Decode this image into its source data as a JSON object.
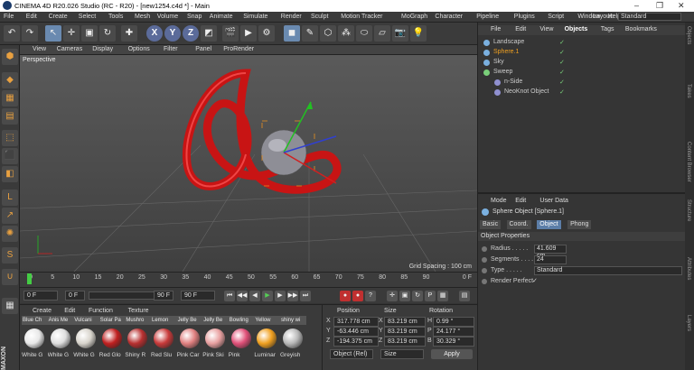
{
  "window": {
    "title": "CINEMA 4D R20.026 Studio (RC - R20) - [new1254.c4d *] - Main",
    "layout_label": "Layout:",
    "layout_value": "Standard"
  },
  "menu": [
    "File",
    "Edit",
    "Create",
    "Select",
    "Tools",
    "Mesh",
    "Volume",
    "Snap",
    "Animate",
    "Simulate",
    "Render",
    "Sculpt",
    "Motion Tracker",
    "MoGraph",
    "Character",
    "Pipeline",
    "Plugins",
    "Script",
    "Window",
    "Help"
  ],
  "viewport": {
    "menu": [
      "View",
      "Cameras",
      "Display",
      "Options",
      "Filter",
      "Panel",
      "ProRender"
    ],
    "camera_label": "Perspective",
    "grid_spacing": "Grid Spacing : 100 cm"
  },
  "timeline": {
    "ticks": [
      "0",
      "5",
      "10",
      "15",
      "20",
      "25",
      "30",
      "35",
      "40",
      "45",
      "50",
      "55",
      "60",
      "65",
      "70",
      "75",
      "80",
      "85",
      "90"
    ],
    "end": "0 F"
  },
  "playbar": {
    "current_frame": "0 F",
    "start_frame": "0 F",
    "end_frame": "90 F",
    "max_frame": "90 F"
  },
  "materials": {
    "menu": [
      "Create",
      "Edit",
      "Function",
      "Texture"
    ],
    "items": [
      {
        "name": "Blue Ch",
        "label": "White G",
        "color": "#e8e8e8"
      },
      {
        "name": "Anis Me",
        "label": "White G",
        "color": "#dedede"
      },
      {
        "name": "Vulcani",
        "label": "White G",
        "color": "#d8d4cc"
      },
      {
        "name": "Solar Pa",
        "label": "Red Glo",
        "color": "#c02020"
      },
      {
        "name": "Mushro",
        "label": "Shiny R",
        "color": "#b83030"
      },
      {
        "name": "Lemon",
        "label": "Red Slu",
        "color": "#c83a3a"
      },
      {
        "name": "Jelly Be",
        "label": "Pink Car",
        "color": "#e08080"
      },
      {
        "name": "Jelly Be",
        "label": "Pink Ski",
        "color": "#e8a0a0"
      },
      {
        "name": "Bowling",
        "label": "Pink",
        "color": "#e05078"
      },
      {
        "name": "Yellow",
        "label": "Luminar",
        "color": "#f0a020"
      },
      {
        "name": "shiny wi",
        "label": "Greyish",
        "color": "#b8b8b8"
      }
    ]
  },
  "coords": {
    "headers": [
      "Position",
      "Size",
      "Rotation"
    ],
    "rows": [
      {
        "axis": "X",
        "pos": "317.778 cm",
        "size": "83.219 cm",
        "rot_axis": "H",
        "rot": "0.99 °"
      },
      {
        "axis": "Y",
        "pos": "-63.446 cm",
        "size": "83.219 cm",
        "rot_axis": "P",
        "rot": "24.177 °"
      },
      {
        "axis": "Z",
        "pos": "-194.375 cm",
        "size": "83.219 cm",
        "rot_axis": "B",
        "rot": "30.329 °"
      }
    ],
    "mode": "Object (Rel)",
    "size_mode": "Size",
    "apply": "Apply"
  },
  "objects": {
    "tabs": [
      "File",
      "Edit",
      "View",
      "Objects",
      "Tags",
      "Bookmarks"
    ],
    "rows": [
      {
        "name": "Landscape",
        "color": "#7ab0e0",
        "indent": 0
      },
      {
        "name": "Sphere.1",
        "color": "#7ab0e0",
        "indent": 0
      },
      {
        "name": "Sky",
        "color": "#7ab0e0",
        "indent": 0
      },
      {
        "name": "Sweep",
        "color": "#7ad07a",
        "indent": 0
      },
      {
        "name": "n-Side",
        "color": "#9090d0",
        "indent": 1
      },
      {
        "name": "NeoKnot Object",
        "color": "#9090d0",
        "indent": 1
      }
    ]
  },
  "attributes": {
    "menu": [
      "Mode",
      "Edit",
      "User Data"
    ],
    "object_title": "Sphere Object [Sphere.1]",
    "tabs": [
      "Basic",
      "Coord.",
      "Object",
      "Phong"
    ],
    "active_tab": "Object",
    "section": "Object Properties",
    "props": [
      {
        "label": "Radius",
        "value": "41.609 cm"
      },
      {
        "label": "Segments",
        "value": "24"
      },
      {
        "label": "Type",
        "value": "Standard"
      },
      {
        "label": "Render Perfect",
        "value": "✓"
      }
    ]
  },
  "right_strip": [
    "Objects",
    "Takes",
    "Content Browser",
    "Structure",
    "Attributes",
    "Layers"
  ]
}
